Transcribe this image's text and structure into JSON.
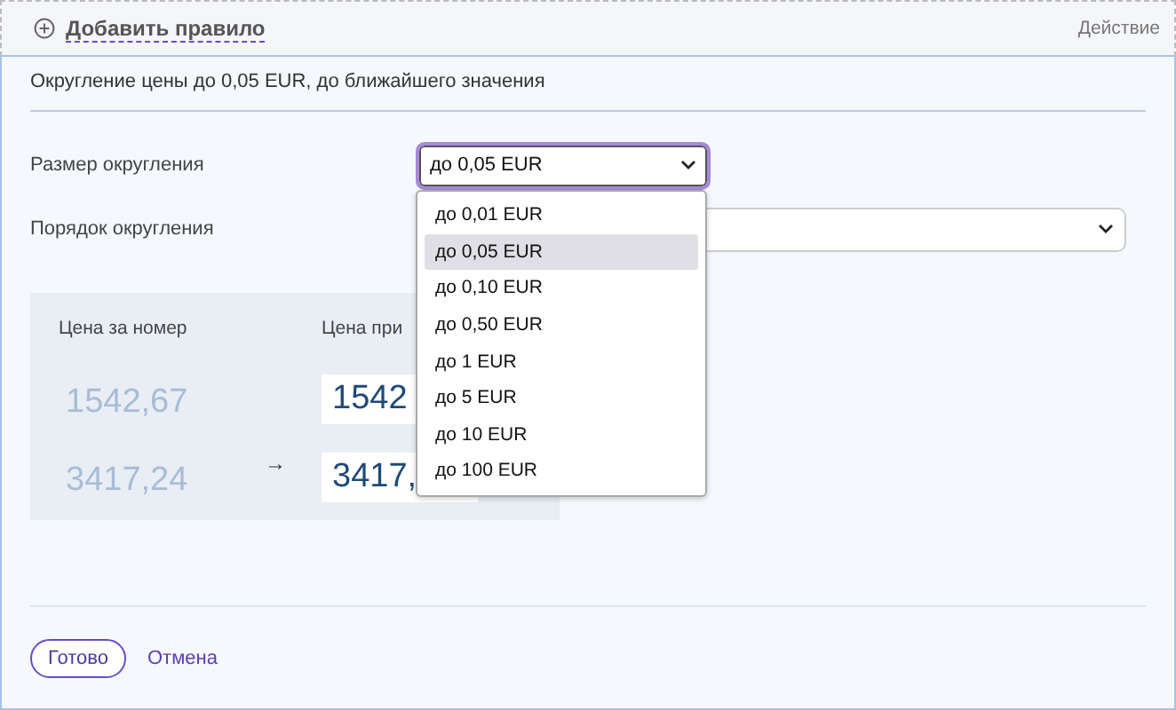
{
  "header": {
    "add_rule": "Добавить правило",
    "column_label": "Действие"
  },
  "summary": "Округление цены до 0,05 EUR, до ближайшего значения",
  "fields": [
    {
      "label": "Размер округления",
      "value": "до 0,05 EUR",
      "focused": true
    },
    {
      "label": "Порядок округления",
      "focused": false
    }
  ],
  "dropdown": {
    "options": [
      {
        "label": "до 0,01 EUR",
        "selected": false
      },
      {
        "label": "до 0,05 EUR",
        "selected": true
      },
      {
        "label": "до 0,10 EUR",
        "selected": false
      },
      {
        "label": "до 0,50 EUR",
        "selected": false
      },
      {
        "label": "до 1 EUR",
        "selected": false
      },
      {
        "label": "до 5 EUR",
        "selected": false
      },
      {
        "label": "до 10 EUR",
        "selected": false
      },
      {
        "label": "до 100 EUR",
        "selected": false
      }
    ]
  },
  "preview": {
    "source_heading": "Цена за номер",
    "result_heading": "Цена при",
    "arrow": "→",
    "rows": [
      {
        "source": "1542,67",
        "result": "1542"
      },
      {
        "source": "3417,24",
        "result": "3417,"
      }
    ]
  },
  "buttons": {
    "done": "Готово",
    "cancel": "Отмена"
  }
}
